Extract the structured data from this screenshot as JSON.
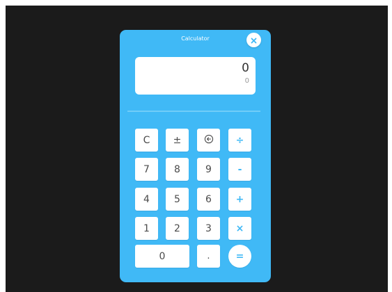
{
  "title": "Calculator",
  "display": {
    "main": "0",
    "secondary": "0"
  },
  "icons": {
    "close": "close-icon",
    "backspace": "backspace-icon"
  },
  "colors": {
    "panel": "#40b9f6",
    "background": "#1b1b1b",
    "button": "#ffffff",
    "accent": "#40b9f6"
  },
  "keys": {
    "clear": "C",
    "plus_minus": "±",
    "divide": "÷",
    "seven": "7",
    "eight": "8",
    "nine": "9",
    "minus": "-",
    "four": "4",
    "five": "5",
    "six": "6",
    "plus": "+",
    "one": "1",
    "two": "2",
    "three": "3",
    "multiply": "×",
    "zero": "0",
    "dot": ".",
    "equals": "="
  }
}
